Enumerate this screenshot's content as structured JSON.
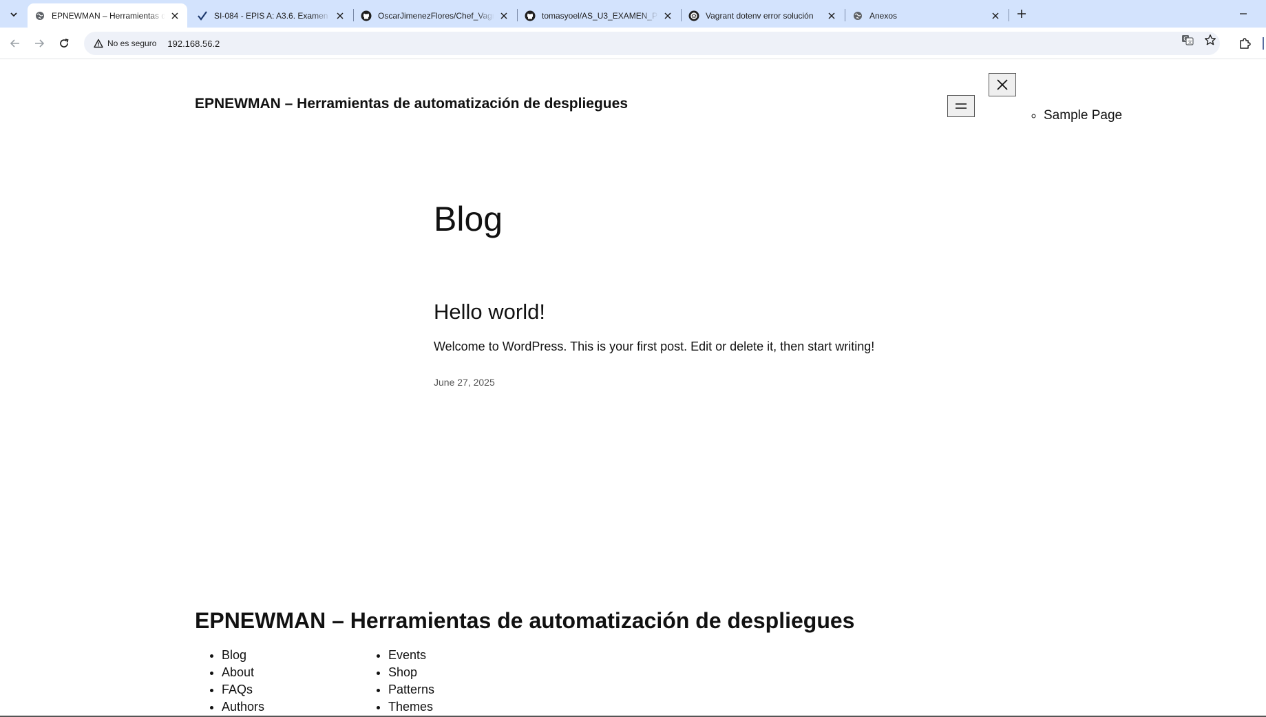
{
  "browser": {
    "tabs": [
      {
        "title": "EPNEWMAN – Herramientas de automatización de despliegues",
        "icon": "globe-icon",
        "active": true
      },
      {
        "title": "SI-084 - EPIS A: A3.6. Examen de",
        "icon": "checkmark-icon",
        "active": false
      },
      {
        "title": "OscarJimenezFlores/Chef_Vagrant",
        "icon": "github-icon",
        "active": false
      },
      {
        "title": "tomasyoel/AS_U3_EXAMEN_PRACTICO",
        "icon": "github-icon",
        "active": false
      },
      {
        "title": "Vagrant dotenv error solución",
        "icon": "openai-icon",
        "active": false
      },
      {
        "title": "Anexos",
        "icon": "globe-icon",
        "active": false
      }
    ],
    "security_label": "No es seguro",
    "url": "192.168.56.2"
  },
  "site": {
    "title": "EPNEWMAN – Herramientas de automatización de despliegues",
    "nav_items": [
      "Sample Page"
    ]
  },
  "main": {
    "heading": "Blog",
    "post": {
      "title": "Hello world!",
      "excerpt": "Welcome to WordPress. This is your first post. Edit or delete it, then start writing!",
      "date": "June 27, 2025"
    }
  },
  "footer": {
    "title": "EPNEWMAN – Herramientas de automatización de despliegues",
    "col1": [
      "Blog",
      "About",
      "FAQs",
      "Authors"
    ],
    "col2": [
      "Events",
      "Shop",
      "Patterns",
      "Themes"
    ]
  }
}
